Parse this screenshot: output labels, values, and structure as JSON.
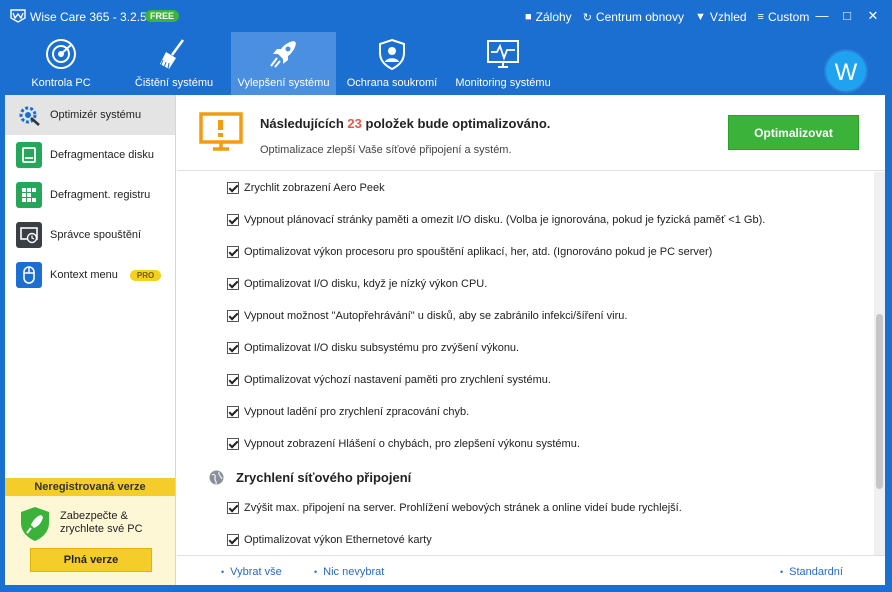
{
  "app": {
    "title": "Wise Care 365 - 3.2.5",
    "badge": "FREE",
    "accent_color": "#1a6fd0"
  },
  "titlebar_links": [
    {
      "icon": "bookmark-icon",
      "glyph": "■",
      "label": "Zálohy"
    },
    {
      "icon": "restore-icon",
      "glyph": "↻",
      "label": "Centrum obnovy"
    },
    {
      "icon": "shirt-icon",
      "glyph": "▼",
      "label": "Vzhled"
    },
    {
      "icon": "menu-icon",
      "glyph": "≡",
      "label": "Custom"
    }
  ],
  "window_controls": {
    "minimize": "—",
    "maximize": "□",
    "close": "✕"
  },
  "nav_tabs": [
    {
      "label": "Kontrola PC",
      "icon": "radar-icon"
    },
    {
      "label": "Čištění systému",
      "icon": "broom-icon"
    },
    {
      "label": "Vylepšení systému",
      "icon": "rocket-icon",
      "active": true
    },
    {
      "label": "Ochrana soukromí",
      "icon": "privacy-shield-icon"
    },
    {
      "label": "Monitoring systému",
      "icon": "monitor-pulse-icon"
    }
  ],
  "avatar": {
    "letter": "W"
  },
  "sidebar": {
    "items": [
      {
        "label": "Optimizér systému",
        "icon": "gear-icon",
        "active": true
      },
      {
        "label": "Defragmentace disku",
        "icon": "disk-icon"
      },
      {
        "label": "Defragment. registru",
        "icon": "registry-icon"
      },
      {
        "label": "Správce spouštění",
        "icon": "startup-icon"
      },
      {
        "label": "Kontext menu",
        "icon": "mouse-icon",
        "badge": "PRO"
      }
    ],
    "promo": {
      "title": "Neregistrovaná verze",
      "text_line1": "Zabezpečte &",
      "text_line2": "zrychlete své PC",
      "button": "Plná verze"
    }
  },
  "header": {
    "title_before": "Následujících ",
    "count": "23",
    "title_after": " položek bude optimalizováno.",
    "subtitle": "Optimalizace zlepší Vaše síťové připojení a systém.",
    "button": "Optimalizovat",
    "button_color": "#3bb33b"
  },
  "options_system": [
    {
      "label": "Zrychlit zobrazení Aero Peek",
      "checked": true
    },
    {
      "label": "Vypnout plánovací stránky paměti a omezit I/O disku. (Volba je ignorována, pokud je fyzická paměť <1 Gb).",
      "checked": true
    },
    {
      "label": "Optimalizovat výkon procesoru pro spouštění aplikací, her, atd. (Ignorováno pokud je PC server)",
      "checked": true
    },
    {
      "label": "Optimalizovat I/O disku, když je nízký výkon CPU.",
      "checked": true
    },
    {
      "label": "Vypnout možnost \"Autopřehrávání\" u disků, aby se zabránilo infekci/šíření viru.",
      "checked": true
    },
    {
      "label": "Optimalizovat I/O disku subsystému pro zvýšení výkonu.",
      "checked": true
    },
    {
      "label": "Optimalizovat výchozí nastavení paměti pro zrychlení systému.",
      "checked": true
    },
    {
      "label": "Vypnout ladění pro zrychlení zpracování chyb.",
      "checked": true
    },
    {
      "label": "Vypnout zobrazení Hlášení o chybách, pro zlepšení výkonu systému.",
      "checked": true
    }
  ],
  "section_network": {
    "title": "Zrychlení síťového připojení",
    "icon": "globe-icon"
  },
  "options_network": [
    {
      "label": "Zvýšit max. připojení na server. Prohlížení webových stránek a online videí bude rychlejší.",
      "checked": true
    },
    {
      "label": "Optimalizovat výkon Ethernetové karty",
      "checked": true
    }
  ],
  "footer": {
    "select_all": "Vybrat vše",
    "select_none": "Nic nevybrat",
    "default": "Standardní"
  }
}
